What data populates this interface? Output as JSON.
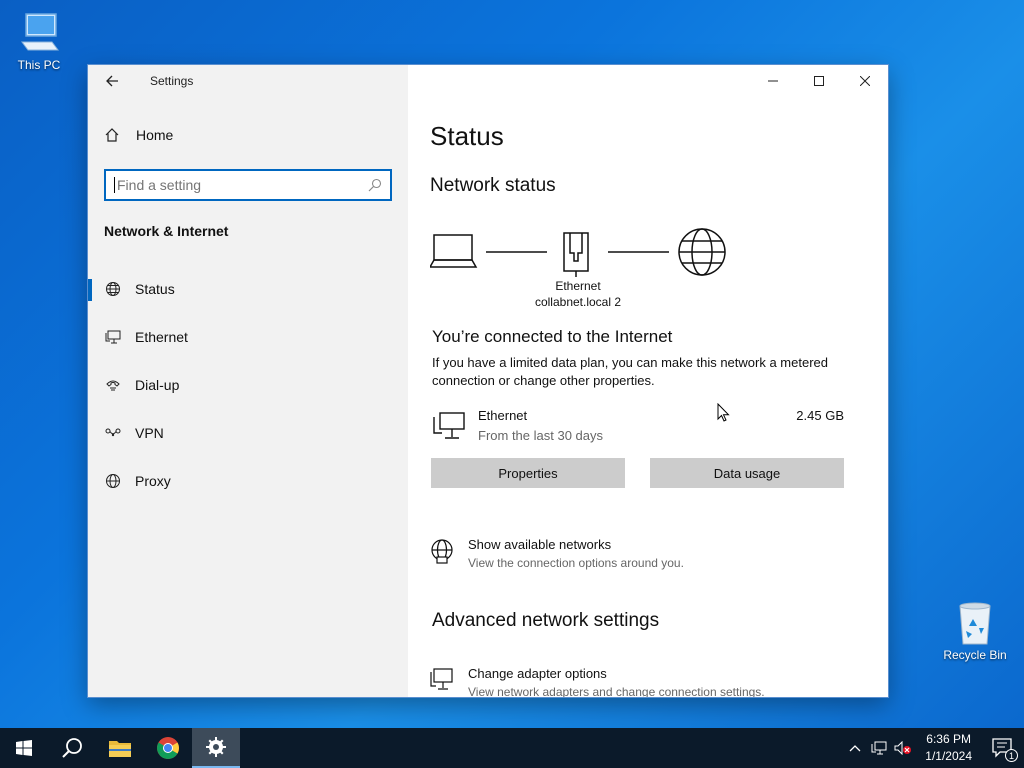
{
  "desktop": {
    "icons": [
      {
        "label": "This PC"
      },
      {
        "label": "Recycle Bin"
      }
    ]
  },
  "window": {
    "title": "Settings",
    "controls": {
      "minimize": "minimize",
      "maximize": "maximize",
      "close": "close"
    }
  },
  "sidebar": {
    "home_label": "Home",
    "search_placeholder": "Find a setting",
    "section_title": "Network & Internet",
    "items": [
      {
        "label": "Status",
        "icon": "globe-status-icon",
        "active": true
      },
      {
        "label": "Ethernet",
        "icon": "ethernet-monitor-icon"
      },
      {
        "label": "Dial-up",
        "icon": "dial-up-icon"
      },
      {
        "label": "VPN",
        "icon": "vpn-icon"
      },
      {
        "label": "Proxy",
        "icon": "globe-icon"
      }
    ]
  },
  "main": {
    "page_title": "Status",
    "network_status_title": "Network status",
    "diagram": {
      "adapter_label": "Ethernet",
      "network_label": "collabnet.local 2"
    },
    "connected_title": "You’re connected to the Internet",
    "connected_desc": "If you have a limited data plan, you can make this network a metered connection or change other properties.",
    "usage": {
      "name": "Ethernet",
      "period": "From the last 30 days",
      "value": "2.45 GB"
    },
    "buttons": {
      "properties": "Properties",
      "data_usage": "Data usage"
    },
    "show_networks": {
      "title": "Show available networks",
      "desc": "View the connection options around you."
    },
    "advanced_title": "Advanced network settings",
    "adapter_options": {
      "title": "Change adapter options",
      "desc": "View network adapters and change connection settings."
    }
  },
  "taskbar": {
    "clock_time": "6:36 PM",
    "clock_date": "1/1/2024",
    "notification_count": "1",
    "accent": "#0067c0"
  }
}
